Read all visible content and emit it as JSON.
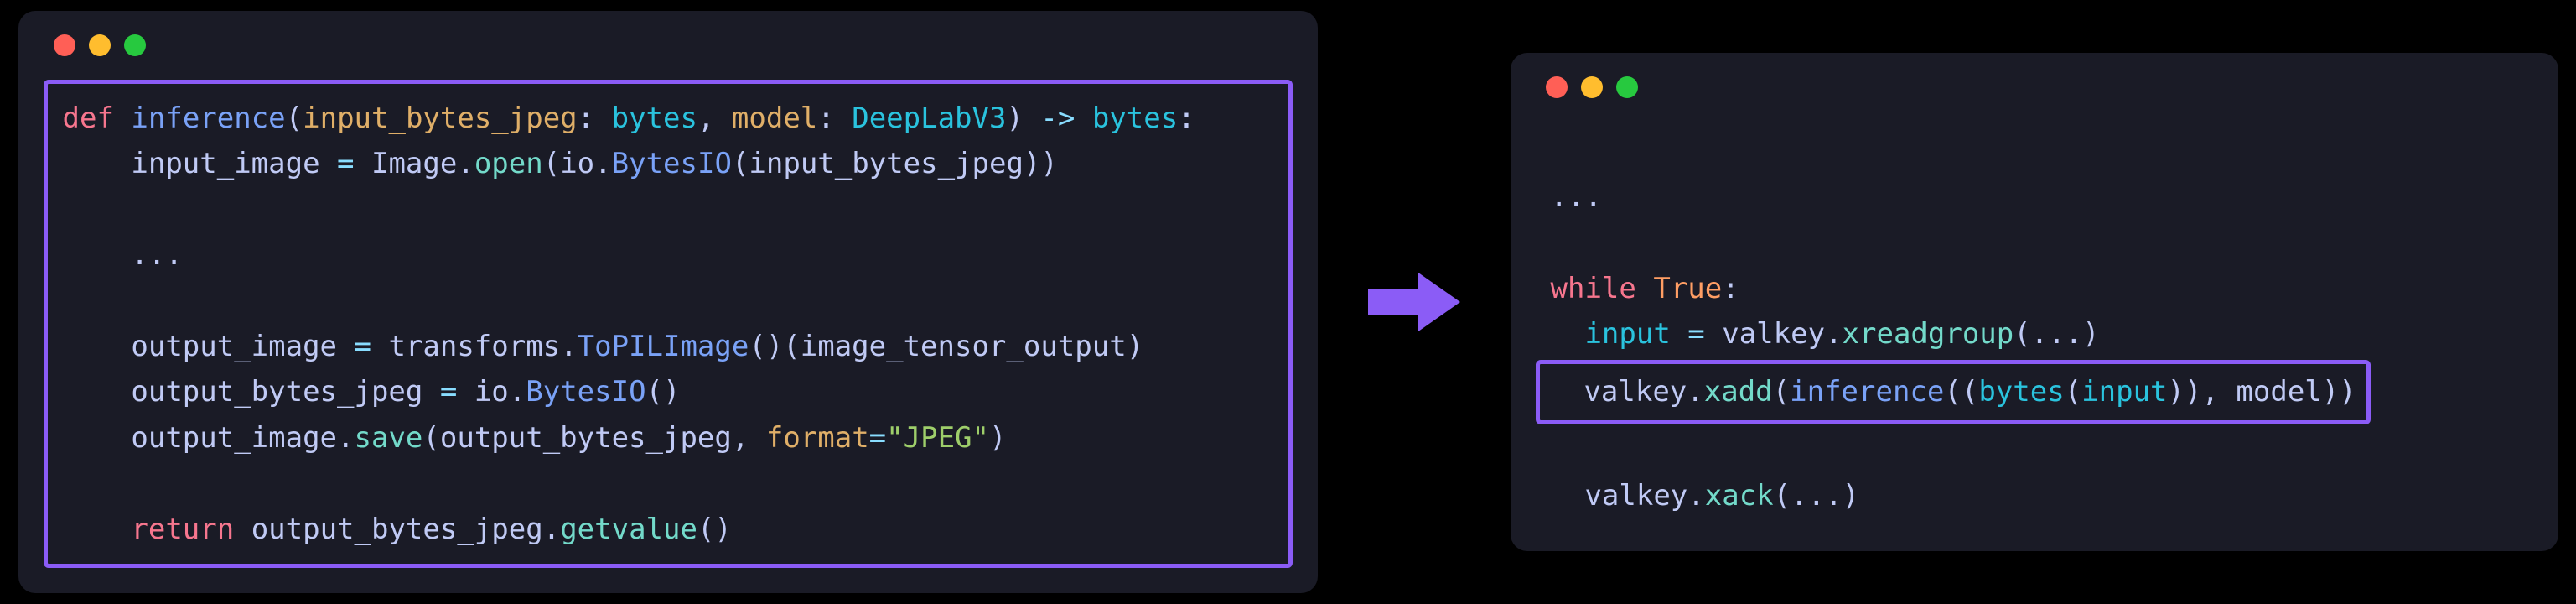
{
  "left": {
    "line1": {
      "def": "def",
      "fn": "inference",
      "open": "(",
      "p1": "input_bytes_jpeg",
      "colon1": ": ",
      "t1": "bytes",
      "comma": ", ",
      "p2": "model",
      "colon2": ": ",
      "t2": "DeepLabV3",
      "close": ") ",
      "arrow": "-> ",
      "ret_t": "bytes",
      "end": ":"
    },
    "line2": {
      "indent": "    ",
      "var": "input_image ",
      "eq": "= ",
      "image": "Image",
      "dot1": ".",
      "open": "open",
      "p1": "(",
      "io": "io",
      "dot2": ".",
      "bio": "BytesIO",
      "p2": "(",
      "arg": "input_bytes_jpeg",
      "close": "))"
    },
    "line_ellipsis": "    ...",
    "line5": {
      "indent": "    ",
      "var": "output_image ",
      "eq": "= ",
      "transforms": "transforms",
      "dot": ".",
      "topil": "ToPILImage",
      "call": "()(",
      "arg": "image_tensor_output",
      "close": ")"
    },
    "line6": {
      "indent": "    ",
      "var": "output_bytes_jpeg ",
      "eq": "= ",
      "io": "io",
      "dot": ".",
      "bio": "BytesIO",
      "call": "()"
    },
    "line7": {
      "indent": "    ",
      "obj": "output_image",
      "dot": ".",
      "save": "save",
      "open": "(",
      "arg": "output_bytes_jpeg",
      "comma": ", ",
      "format_kw": "format",
      "eq": "=",
      "str": "\"JPEG\"",
      "close": ")"
    },
    "line_ret": {
      "indent": "    ",
      "return": "return",
      "space": " ",
      "obj": "output_bytes_jpeg",
      "dot": ".",
      "getval": "getvalue",
      "call": "()"
    }
  },
  "right": {
    "ellipsis_top": "...",
    "while_line": {
      "while": "while",
      "space": " ",
      "true": "True",
      "colon": ":"
    },
    "input_line": {
      "indent": "  ",
      "var": "input",
      "eq": " = ",
      "valkey": "valkey",
      "dot": ".",
      "method": "xreadgroup",
      "open": "(",
      "dots": "...",
      "close": ")"
    },
    "xadd_line": {
      "indent": "  ",
      "valkey": "valkey",
      "dot": ".",
      "xadd": "xadd",
      "open": "(",
      "inference": "inference",
      "p1": "((",
      "bytes": "bytes",
      "p2": "(",
      "input": "input",
      "p3": ")), ",
      "model": "model",
      "close": "))"
    },
    "xack_line": {
      "indent": "  ",
      "valkey": "valkey",
      "dot": ".",
      "xack": "xack",
      "open": "(",
      "dots": "...",
      "close": ")"
    }
  }
}
